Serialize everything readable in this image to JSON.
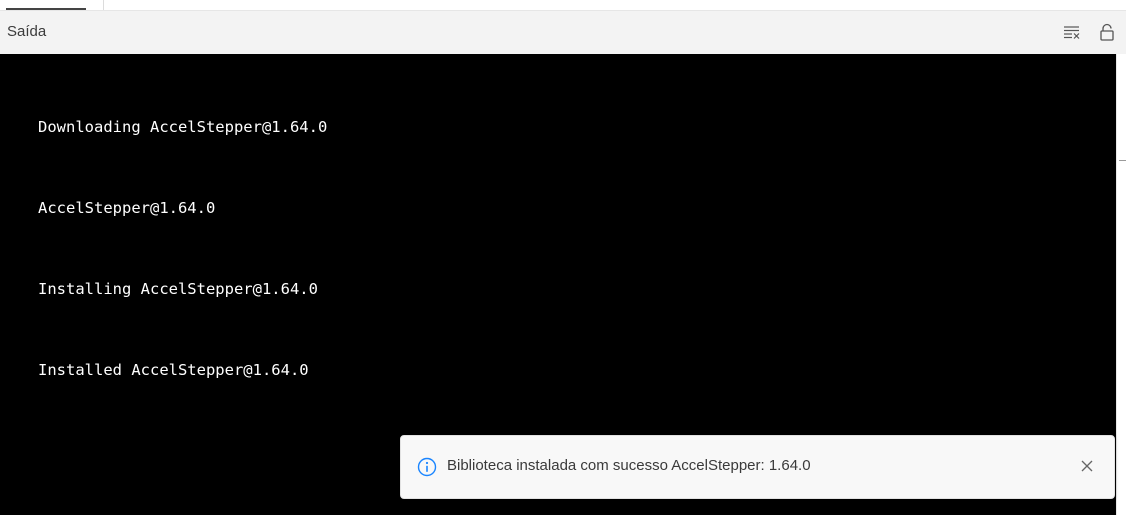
{
  "panel": {
    "title": "Saída",
    "icons": [
      "clear-output-icon",
      "lock-scroll-icon"
    ]
  },
  "output": {
    "lines": [
      "Downloading AccelStepper@1.64.0",
      "AccelStepper@1.64.0",
      "Installing AccelStepper@1.64.0",
      "Installed AccelStepper@1.64.0"
    ]
  },
  "notification": {
    "message": "Biblioteca instalada com sucesso AccelStepper: 1.64.0",
    "icon": "info-icon",
    "close_icon": "close-icon",
    "accent": "#1a85ff"
  },
  "colors": {
    "output_background": "#000000",
    "output_text": "#ffffff",
    "header_background": "#f3f3f3"
  }
}
